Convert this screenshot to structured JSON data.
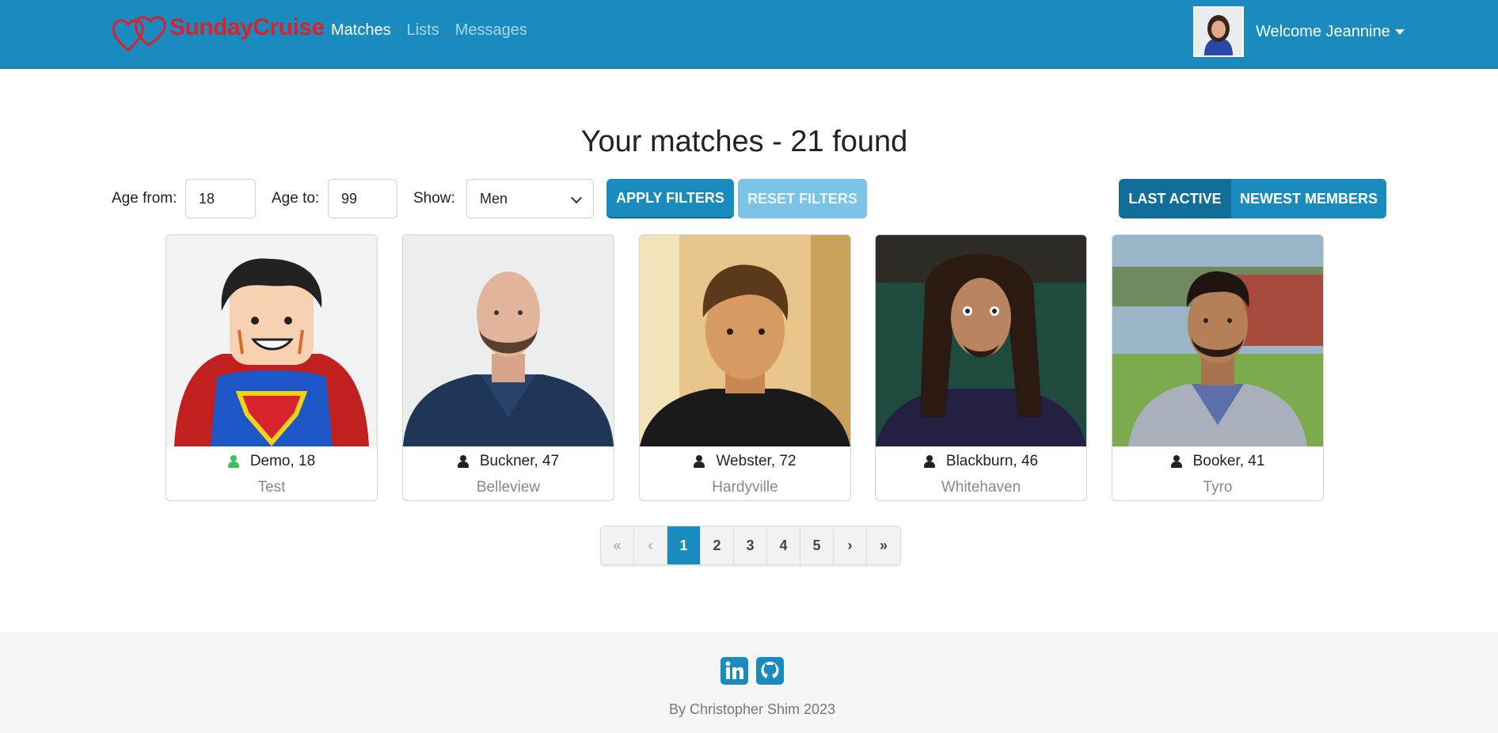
{
  "navbar": {
    "brand": "SundayCruise",
    "links": [
      {
        "label": "Matches",
        "active": true
      },
      {
        "label": "Lists",
        "active": false
      },
      {
        "label": "Messages",
        "active": false
      }
    ],
    "welcome": "Welcome Jeannine"
  },
  "heading": "Your matches - 21 found",
  "filters": {
    "age_from_label": "Age from:",
    "age_from_value": "18",
    "age_to_label": "Age to:",
    "age_to_value": "99",
    "show_label": "Show:",
    "show_value": "Men",
    "apply_label": "APPLY FILTERS",
    "reset_label": "RESET FILTERS"
  },
  "sort": {
    "last_active": "LAST ACTIVE",
    "newest_members": "NEWEST MEMBERS",
    "selected": "last_active"
  },
  "matches": [
    {
      "name": "Demo, 18",
      "city": "Test",
      "online": true
    },
    {
      "name": "Buckner, 47",
      "city": "Belleview",
      "online": false
    },
    {
      "name": "Webster, 72",
      "city": "Hardyville",
      "online": false
    },
    {
      "name": "Blackburn, 46",
      "city": "Whitehaven",
      "online": false
    },
    {
      "name": "Booker, 41",
      "city": "Tyro",
      "online": false
    }
  ],
  "pagination": {
    "first": "«",
    "prev": "‹",
    "pages": [
      "1",
      "2",
      "3",
      "4",
      "5"
    ],
    "current": "1",
    "next": "›",
    "last": "»"
  },
  "footer": {
    "icons": [
      "linkedin-icon",
      "github-icon"
    ],
    "text": "By Christopher Shim 2023"
  },
  "colors": {
    "primary": "#1a8bbf",
    "brand_red": "#d8222d",
    "online": "#3cbf5a",
    "offline": "#222222"
  }
}
